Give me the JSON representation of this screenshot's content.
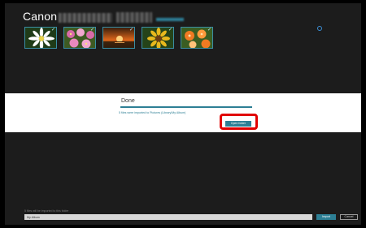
{
  "header": {
    "brand": "Canon"
  },
  "thumbnails": [
    {
      "name": "daisy-thumbnail",
      "check": "✓",
      "palette": [
        "#1f3b18",
        "#ffffff",
        "#e8d24a"
      ]
    },
    {
      "name": "pink-flowers-thumbnail",
      "check": "✓",
      "palette": [
        "#3e5a22",
        "#d86aa8",
        "#f2a8d0"
      ]
    },
    {
      "name": "sunset-thumbnail",
      "check": "✓",
      "palette": [
        "#2a1a0a",
        "#d9641a",
        "#ffd07a"
      ]
    },
    {
      "name": "sunflower-thumbnail",
      "check": "✓",
      "palette": [
        "#254319",
        "#e9b91d",
        "#6b3d12"
      ]
    },
    {
      "name": "orange-flowers-thumbnail",
      "check": "✓",
      "palette": [
        "#3a5d22",
        "#f07a22",
        "#ffc27a"
      ]
    }
  ],
  "import_status": {
    "title": "Done",
    "subtitle": "5 files were imported to Pictures (Library\\My Album)",
    "open_button": "Open folder",
    "accent": "#2d7f95",
    "highlight_color": "#e10000"
  },
  "footer": {
    "destination_label": "5 files will be imported to this folder",
    "folder_value": "My Album",
    "import_button": "Import",
    "cancel_button": "Cancel"
  }
}
